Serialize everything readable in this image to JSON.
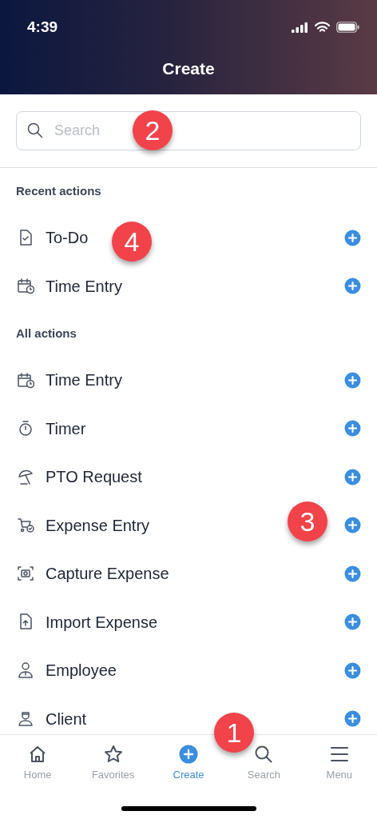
{
  "status_bar": {
    "time": "4:39"
  },
  "header": {
    "title": "Create"
  },
  "search": {
    "placeholder": "Search"
  },
  "sections": [
    {
      "title": "Recent actions",
      "items": [
        {
          "label": "To-Do"
        },
        {
          "label": "Time Entry"
        }
      ]
    },
    {
      "title": "All actions",
      "items": [
        {
          "label": "Time Entry"
        },
        {
          "label": "Timer"
        },
        {
          "label": "PTO Request"
        },
        {
          "label": "Expense Entry"
        },
        {
          "label": "Capture Expense"
        },
        {
          "label": "Import Expense"
        },
        {
          "label": "Employee"
        },
        {
          "label": "Client"
        }
      ]
    }
  ],
  "tab_bar": [
    {
      "label": "Home",
      "selected": false
    },
    {
      "label": "Favorites",
      "selected": false
    },
    {
      "label": "Create",
      "selected": true
    },
    {
      "label": "Search",
      "selected": false
    },
    {
      "label": "Menu",
      "selected": false
    }
  ],
  "callouts": [
    "1",
    "2",
    "3",
    "4"
  ]
}
